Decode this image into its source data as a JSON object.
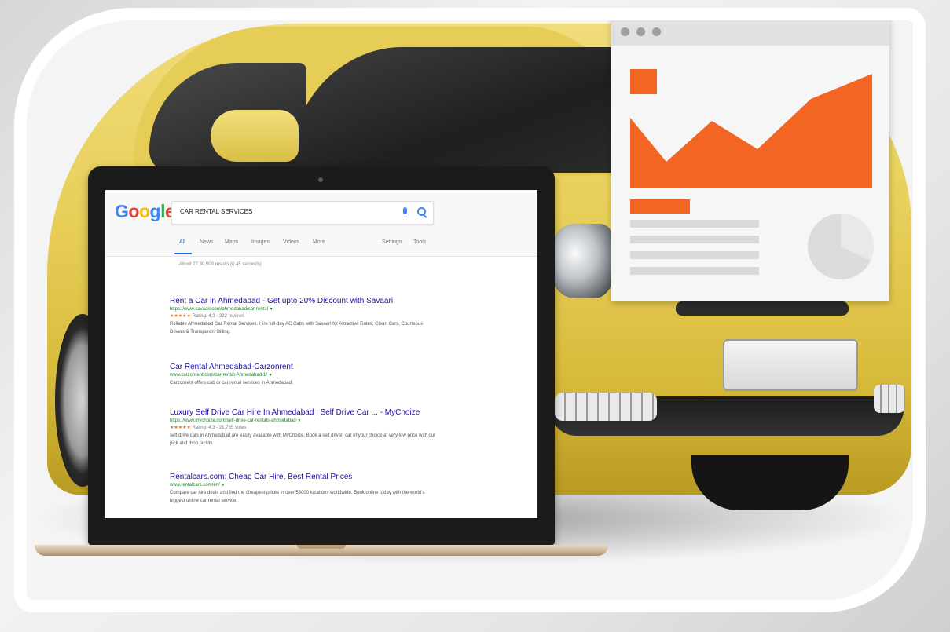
{
  "search": {
    "logo": [
      "G",
      "o",
      "o",
      "g",
      "l",
      "e"
    ],
    "logo_colors": [
      "#4285f4",
      "#ea4335",
      "#fbbc05",
      "#4285f4",
      "#34a853",
      "#ea4335"
    ],
    "query": "CAR RENTAL SERVICES",
    "tabs": [
      "All",
      "News",
      "Maps",
      "Images",
      "Videos",
      "More"
    ],
    "right_tabs": [
      "Settings",
      "Tools"
    ],
    "stats": "About 27,30,000 results (0.45 seconds)"
  },
  "results": [
    {
      "title": "Rent a Car in Ahmedabad - Get upto 20% Discount with Savaari",
      "url": "https://www.savaari.com/ahmedabad/car-rental",
      "stars": "★★★★★",
      "rating": "Rating: 4.3 - 322 reviews",
      "snippet": "Reliable Ahmedabad Car Rental Services. Hire full-day AC Cabs with Savaari for Attractive Rates, Clean Cars, Courteous Drivers & Transparent Billing."
    },
    {
      "title": "Car Rental Ahmedabad-Carzonrent",
      "url": "www.carzonrent.com/car-rental-Ahmedabad-1/",
      "stars": "",
      "rating": "",
      "snippet": "Carzonrent offers cab or car rental services in Ahmedabad."
    },
    {
      "title": "Luxury Self Drive Car Hire In Ahmedabad | Self Drive Car ... - MyChoize",
      "url": "https://www.mychoize.com/self-drive-car-rentals-ahmedabad",
      "stars": "★★★★★",
      "rating": "Rating: 4.3 - 21,765 votes",
      "snippet": "self drive cars in Ahmedabad are easily available with MyChoize. Book a self driven car of your choice at very low price with our pick and drop facility."
    },
    {
      "title": "Rentalcars.com: Cheap Car Hire, Best Rental Prices",
      "url": "www.rentalcars.com/en/",
      "stars": "",
      "rating": "",
      "snippet": "Compare car hire deals and find the cheapest prices in over 53000 locations worldwide. Book online today with the world's biggest online car rental service."
    }
  ],
  "colors": {
    "accent": "#f26522",
    "link": "#1a0dab",
    "url": "#207a2f",
    "car": "#e8cf5a"
  },
  "icons": [
    "mic-icon",
    "search-icon",
    "window-dot-icon",
    "pie-chart-icon"
  ]
}
